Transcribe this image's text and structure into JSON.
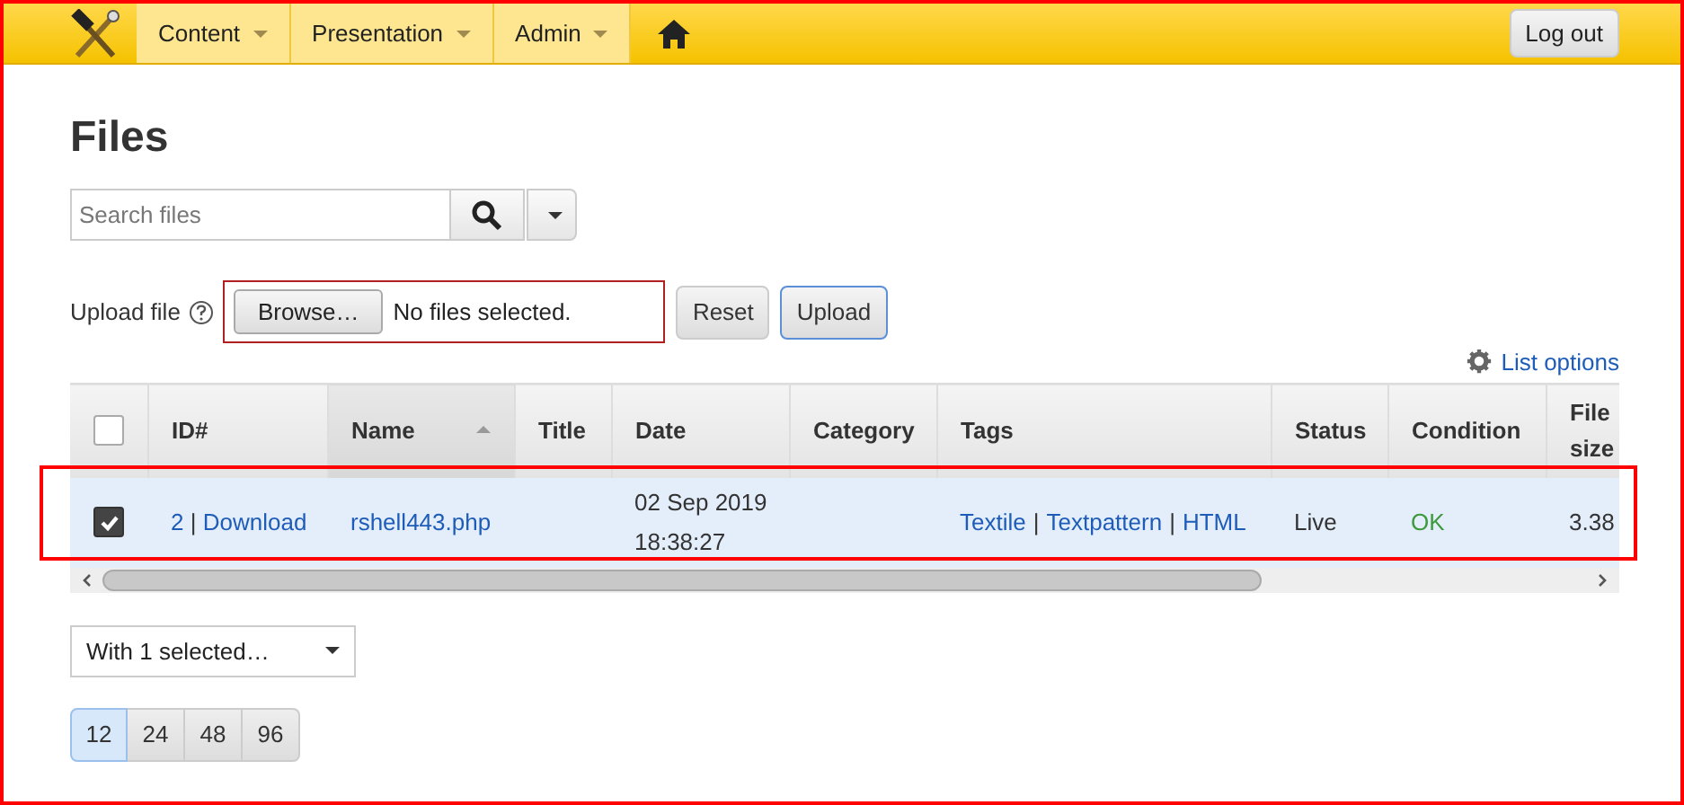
{
  "nav": {
    "menus": [
      {
        "label": "Content",
        "selected": false
      },
      {
        "label": "Presentation",
        "selected": false
      },
      {
        "label": "Admin",
        "selected": false
      }
    ],
    "logout": "Log out"
  },
  "title": "Files",
  "search": {
    "placeholder": "Search files"
  },
  "upload": {
    "label": "Upload file",
    "browse": "Browse…",
    "status": "No files selected.",
    "buttons": [
      "Reset",
      "Upload"
    ]
  },
  "list_options": "List options",
  "table": {
    "all_checked": false,
    "columns": [
      {
        "label": "ID#",
        "sorted": false
      },
      {
        "label": "Name",
        "sorted": true
      },
      {
        "label": "Title",
        "sorted": false
      },
      {
        "label": "Date",
        "sorted": false
      },
      {
        "label": "Category",
        "sorted": false
      },
      {
        "label": "Tags",
        "sorted": false
      },
      {
        "label": "Status",
        "sorted": false
      },
      {
        "label": "Condition",
        "sorted": false
      },
      {
        "label": "File size",
        "sorted": false
      }
    ],
    "rows": [
      {
        "separator": "|",
        "checked": true,
        "selected": true,
        "id": "2",
        "download": "Download",
        "name": "rshell443.php",
        "date": "02 Sep 2019",
        "time": "18:38:27",
        "tags": [
          "Textile",
          "Textpattern",
          "HTML"
        ],
        "status": "Live",
        "condition": "OK",
        "file_size": "3.38"
      }
    ]
  },
  "bulk": "With 1 selected…",
  "page_sizes": [
    {
      "label": "12",
      "selected": true
    },
    {
      "label": "24",
      "selected": false
    },
    {
      "label": "48",
      "selected": false
    },
    {
      "label": "96",
      "selected": false
    }
  ]
}
